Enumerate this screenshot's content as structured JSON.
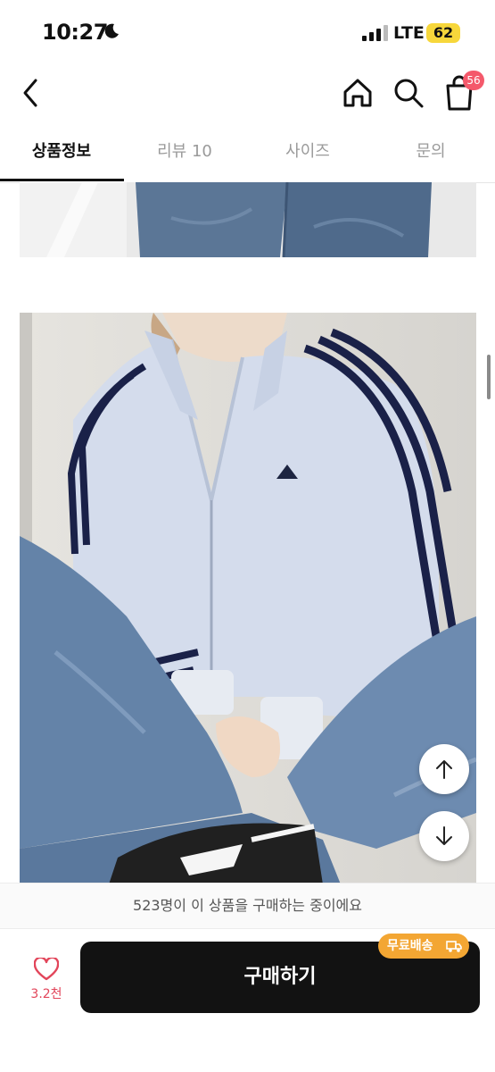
{
  "status_bar": {
    "time": "10:27",
    "network": "LTE",
    "battery": "62"
  },
  "nav": {
    "cart_badge": "56"
  },
  "tabs": [
    {
      "label": "상품정보"
    },
    {
      "label": "리뷰 10"
    },
    {
      "label": "사이즈"
    },
    {
      "label": "문의"
    }
  ],
  "viewers_text": "523명이 이 상품을 구매하는 중이에요",
  "like": {
    "count": "3.2천"
  },
  "buy": {
    "label": "구매하기",
    "badge": "무료배송"
  },
  "colors": {
    "like_accent": "#e2455a",
    "badge_red": "#f4596b",
    "free_ship": "#f3a633",
    "buy_button": "#121212",
    "battery": "#f7d73b"
  }
}
